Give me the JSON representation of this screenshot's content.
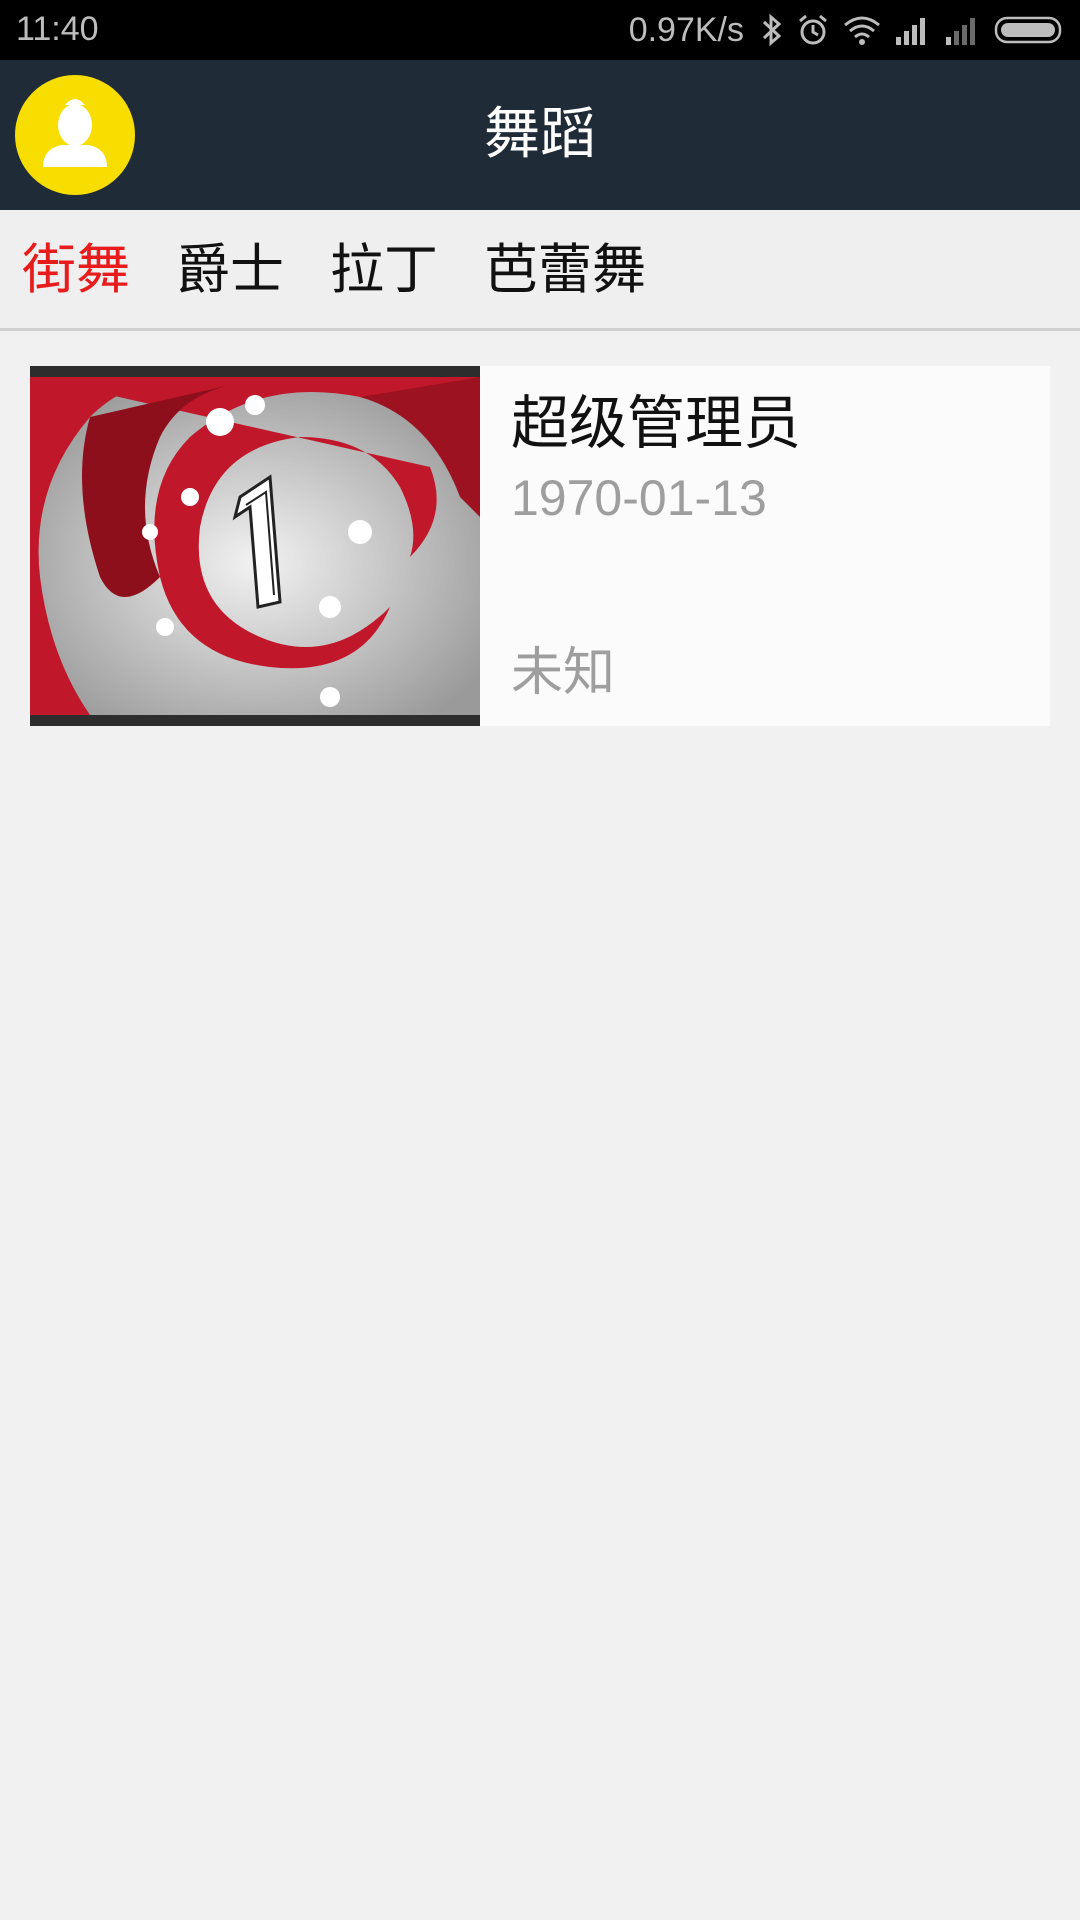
{
  "status_bar": {
    "time": "11:40",
    "net_speed": "0.97K/s",
    "icons": [
      "bluetooth-icon",
      "alarm-icon",
      "wifi-icon",
      "signal-icon",
      "signal-weak-icon",
      "battery-icon"
    ]
  },
  "header": {
    "title": "舞蹈",
    "avatar_icon": "user-avatar-icon",
    "avatar_color": "#f7dd00",
    "background": "#202b38"
  },
  "tabs": [
    {
      "label": "街舞",
      "active": true
    },
    {
      "label": "爵士",
      "active": false
    },
    {
      "label": "拉丁",
      "active": false
    },
    {
      "label": "芭蕾舞",
      "active": false
    }
  ],
  "colors": {
    "active_tab": "#e81c1c",
    "meta_text": "#9e9e9e"
  },
  "list": [
    {
      "thumbnail_icon": "video-thumbnail-countdown-1",
      "title": "超级管理员",
      "date": "1970-01-13",
      "status": "未知"
    }
  ]
}
